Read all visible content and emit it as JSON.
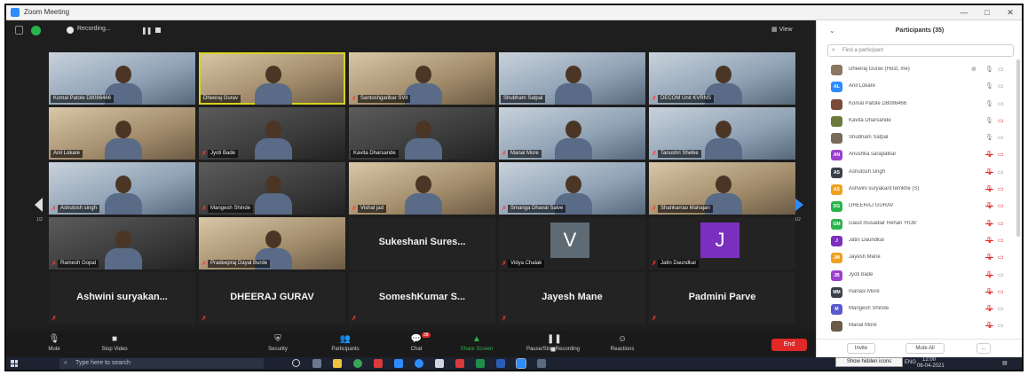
{
  "window": {
    "title": "Zoom Meeting",
    "min": "—",
    "max": "□",
    "close": "✕"
  },
  "topbar": {
    "recording_label": "Recording...",
    "view_label": "View"
  },
  "grid": {
    "page_left": "1/2",
    "page_right": "1/2",
    "tiles": [
      {
        "name": "Komal Patole D8086466",
        "kind": "video",
        "tone": "cool",
        "muted": false
      },
      {
        "name": "Dheeraj Gurav",
        "kind": "video",
        "tone": "warm",
        "muted": false,
        "active": true
      },
      {
        "name": "Santoshgaribar SVit",
        "kind": "video",
        "tone": "warm",
        "muted": true
      },
      {
        "name": "Shubham Satpal",
        "kind": "video",
        "tone": "cool",
        "muted": false
      },
      {
        "name": "DECOM Unit KVRNS",
        "kind": "video",
        "tone": "cool",
        "muted": true
      },
      {
        "name": "Anil Lokare",
        "kind": "video",
        "tone": "warm",
        "muted": false
      },
      {
        "name": "Jyoti Bade",
        "kind": "video",
        "tone": "dark",
        "muted": true
      },
      {
        "name": "Kavita Dharsande",
        "kind": "video",
        "tone": "dark",
        "muted": false
      },
      {
        "name": "Manal More",
        "kind": "video",
        "tone": "cool",
        "muted": true
      },
      {
        "name": "Tanushri Shelke",
        "kind": "video",
        "tone": "cool",
        "muted": true
      },
      {
        "name": "Ashutosh singh",
        "kind": "video",
        "tone": "cool",
        "muted": true
      },
      {
        "name": "Mangesh Shinde",
        "kind": "video",
        "tone": "dark",
        "muted": true
      },
      {
        "name": "Vishal jad",
        "kind": "video",
        "tone": "warm",
        "muted": true
      },
      {
        "name": "Smanga Dhaval Salve",
        "kind": "video",
        "tone": "cool",
        "muted": true
      },
      {
        "name": "Shankarrao Mahajan",
        "kind": "video",
        "tone": "warm",
        "muted": true
      },
      {
        "name": "Ramesh Gopal",
        "kind": "video",
        "tone": "dark",
        "muted": true
      },
      {
        "name": "Pradeepraj Dayal Burde",
        "kind": "video",
        "tone": "warm",
        "muted": true
      },
      {
        "name": "Sukeshani Sures...",
        "kind": "name",
        "muted": false
      },
      {
        "name": "Vidya Chalak",
        "kind": "initial",
        "initial": "V",
        "color": "#5f6b74",
        "muted": true
      },
      {
        "name": "Jatin Daundkar",
        "kind": "initial",
        "initial": "J",
        "color": "#7b2fbe",
        "muted": true
      },
      {
        "name": "Ashwini suryakan...",
        "kind": "name",
        "muted": true
      },
      {
        "name": "DHEERAJ GURAV",
        "kind": "name",
        "muted": true
      },
      {
        "name": "SomeshKumar S...",
        "kind": "name",
        "muted": true
      },
      {
        "name": "Jayesh Mane",
        "kind": "name",
        "muted": true
      },
      {
        "name": "Padmini Parve",
        "kind": "name",
        "muted": true
      }
    ]
  },
  "toolbar": {
    "mute": "Mute",
    "stop_video": "Stop Video",
    "security": "Security",
    "participants": "Participants",
    "participants_count": "35",
    "chat": "Chat",
    "chat_badge": "38",
    "share_screen": "Share Screen",
    "pause_recording": "Pause/Stop Recording",
    "reactions": "Reactions",
    "end": "End"
  },
  "panel": {
    "title": "Participants (35)",
    "search_placeholder": "Find a participant",
    "invite": "Invite",
    "mute_all": "Mute All",
    "more": "...",
    "participants": [
      {
        "name": "Dheeraj Gurav (Host, me)",
        "avatar": "",
        "color": "#8a7660",
        "mic": "on",
        "cam": "on",
        "host": true
      },
      {
        "name": "Anil Lokare",
        "avatar": "AL",
        "color": "#2d8cff",
        "mic": "on",
        "cam": "on"
      },
      {
        "name": "Komal Patole D8086466",
        "avatar": "",
        "color": "#7a4a3a",
        "mic": "on",
        "cam": "on"
      },
      {
        "name": "Kavita Dharsande",
        "avatar": "",
        "color": "#6b7a3a",
        "mic": "on",
        "cam": "off"
      },
      {
        "name": "Shubham Satpal",
        "avatar": "",
        "color": "#7a6a5a",
        "mic": "on",
        "cam": "on"
      },
      {
        "name": "Anushka sarapatkar",
        "avatar": "AN",
        "color": "#9b3fcf",
        "mic": "off",
        "cam": "off"
      },
      {
        "name": "Ashutosh singh",
        "avatar": "AS",
        "color": "#3a3f4a",
        "mic": "off",
        "cam": "on"
      },
      {
        "name": "Ashwini suryakant temkhe (S)",
        "avatar": "AS",
        "color": "#f0a020",
        "mic": "off",
        "cam": "off"
      },
      {
        "name": "DHEERAJ GURAV",
        "avatar": "DG",
        "color": "#2bb24c",
        "mic": "off",
        "cam": "off"
      },
      {
        "name": "Gaud musadiar Rehan 'HUB'",
        "avatar": "GM",
        "color": "#2bb24c",
        "mic": "off",
        "cam": "off"
      },
      {
        "name": "Jatin Daundkar",
        "avatar": "J",
        "color": "#7b2fbe",
        "mic": "off",
        "cam": "off"
      },
      {
        "name": "Jayesh Mane",
        "avatar": "JM",
        "color": "#f0a020",
        "mic": "off",
        "cam": "off"
      },
      {
        "name": "Jyoti bade",
        "avatar": "JB",
        "color": "#9b3fcf",
        "mic": "off",
        "cam": "on"
      },
      {
        "name": "manasi More",
        "avatar": "MM",
        "color": "#3a3f4a",
        "mic": "off",
        "cam": "off"
      },
      {
        "name": "Mangesh Shinde",
        "avatar": "M",
        "color": "#5a5acf",
        "mic": "off",
        "cam": "on"
      },
      {
        "name": "Manal More",
        "avatar": "",
        "color": "#6a5a4a",
        "mic": "off",
        "cam": "on"
      }
    ]
  },
  "taskbar": {
    "search_placeholder": "Type here to search",
    "tooltip": "Show hidden icons",
    "lang": "ENG",
    "time": "12:00",
    "date": "06-04-2021"
  }
}
